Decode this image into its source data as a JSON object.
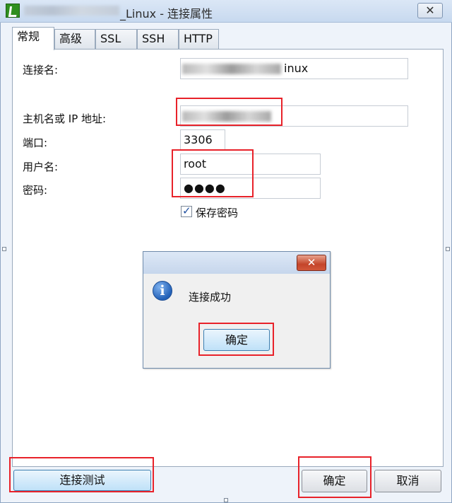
{
  "window": {
    "title_suffix": "_Linux - 连接属性",
    "close_glyph": "✕"
  },
  "tabs": [
    {
      "label": "常规",
      "active": true
    },
    {
      "label": "高级"
    },
    {
      "label": "SSL"
    },
    {
      "label": "SSH"
    },
    {
      "label": "HTTP"
    }
  ],
  "form": {
    "connection_name_label": "连接名:",
    "connection_name_value_visible": "inux",
    "host_label": "主机名或 IP 地址:",
    "port_label": "端口:",
    "port_value": "3306",
    "user_label": "用户名:",
    "user_value": "root",
    "password_label": "密码:",
    "password_value": "●●●●",
    "save_password_label": "保存密码",
    "save_password_checked": true
  },
  "dialog": {
    "close_glyph": "✕",
    "icon": "info-icon",
    "message": "连接成功",
    "ok_label": "确定"
  },
  "footer": {
    "test_connection_label": "连接测试",
    "ok_label": "确定",
    "cancel_label": "取消"
  },
  "colors": {
    "highlight_red": "#e8222a",
    "title_gradient_top": "#dbe7f6",
    "focus_button": "#bfe1f8"
  }
}
